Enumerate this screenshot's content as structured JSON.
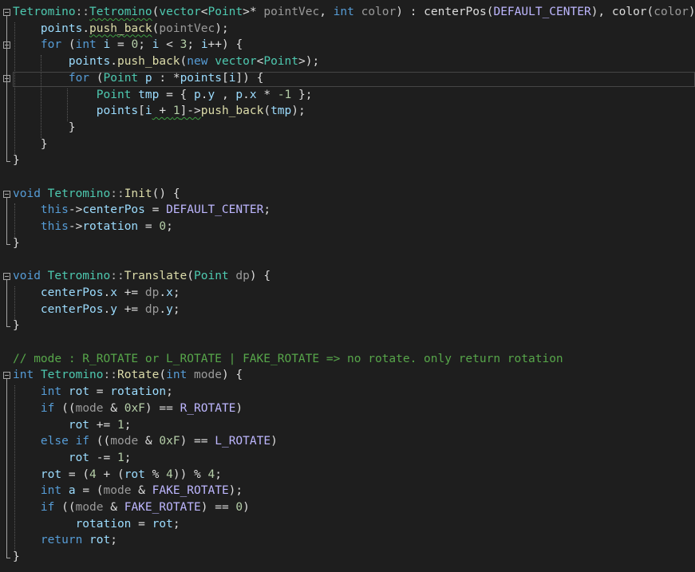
{
  "editor": {
    "lines": [
      {
        "tokens": [
          [
            "t",
            "Tetromino"
          ],
          [
            "o",
            "::"
          ],
          [
            "t",
            "Tetromino"
          ],
          [
            "d",
            "("
          ],
          [
            "t",
            "vector"
          ],
          [
            "d",
            "<"
          ],
          [
            "t",
            "Point"
          ],
          [
            "d",
            ">* "
          ],
          [
            "p",
            "pointVec"
          ],
          [
            "d",
            ", "
          ],
          [
            "k",
            "int"
          ],
          [
            "d",
            " "
          ],
          [
            "p",
            "color"
          ],
          [
            "d",
            ") : centerPos("
          ],
          [
            "m",
            "DEFAULT_CENTER"
          ],
          [
            "d",
            "), color("
          ],
          [
            "p",
            "color"
          ],
          [
            "d",
            ") {"
          ]
        ]
      },
      {
        "tokens": [
          [
            "d",
            "    "
          ],
          [
            "v",
            "points"
          ],
          [
            "d",
            "."
          ],
          [
            "f",
            "push_back"
          ],
          [
            "d",
            "("
          ],
          [
            "p",
            "pointVec"
          ],
          [
            "d",
            ");"
          ]
        ]
      },
      {
        "tokens": [
          [
            "d",
            "    "
          ],
          [
            "k",
            "for"
          ],
          [
            "d",
            " ("
          ],
          [
            "k",
            "int"
          ],
          [
            "d",
            " "
          ],
          [
            "v",
            "i"
          ],
          [
            "d",
            " = "
          ],
          [
            "n",
            "0"
          ],
          [
            "d",
            "; "
          ],
          [
            "v",
            "i"
          ],
          [
            "d",
            " < "
          ],
          [
            "n",
            "3"
          ],
          [
            "d",
            "; "
          ],
          [
            "v",
            "i"
          ],
          [
            "d",
            "++) {"
          ]
        ]
      },
      {
        "tokens": [
          [
            "d",
            "        "
          ],
          [
            "v",
            "points"
          ],
          [
            "d",
            "."
          ],
          [
            "f",
            "push_back"
          ],
          [
            "d",
            "("
          ],
          [
            "k",
            "new"
          ],
          [
            "d",
            " "
          ],
          [
            "t",
            "vector"
          ],
          [
            "d",
            "<"
          ],
          [
            "t",
            "Point"
          ],
          [
            "d",
            ">);"
          ]
        ]
      },
      {
        "tokens": [
          [
            "d",
            "        "
          ],
          [
            "k",
            "for"
          ],
          [
            "d",
            " ("
          ],
          [
            "t",
            "Point"
          ],
          [
            "d",
            " "
          ],
          [
            "v",
            "p"
          ],
          [
            "d",
            " : *"
          ],
          [
            "v",
            "points"
          ],
          [
            "d",
            "["
          ],
          [
            "v",
            "i"
          ],
          [
            "d",
            "]) {"
          ]
        ]
      },
      {
        "tokens": [
          [
            "d",
            "            "
          ],
          [
            "t",
            "Point"
          ],
          [
            "d",
            " "
          ],
          [
            "v",
            "tmp"
          ],
          [
            "d",
            " = { "
          ],
          [
            "v",
            "p"
          ],
          [
            "d",
            "."
          ],
          [
            "v",
            "y"
          ],
          [
            "d",
            " , "
          ],
          [
            "v",
            "p"
          ],
          [
            "d",
            "."
          ],
          [
            "v",
            "x"
          ],
          [
            "d",
            " * "
          ],
          [
            "n",
            "-1"
          ],
          [
            "d",
            " };"
          ]
        ]
      },
      {
        "tokens": [
          [
            "d",
            "            "
          ],
          [
            "v",
            "points"
          ],
          [
            "d",
            "["
          ],
          [
            "v",
            "i"
          ],
          [
            "d",
            " + "
          ],
          [
            "n",
            "1"
          ],
          [
            "d",
            "]->"
          ],
          [
            "f",
            "push_back"
          ],
          [
            "d",
            "("
          ],
          [
            "v",
            "tmp"
          ],
          [
            "d",
            ");"
          ]
        ]
      },
      {
        "tokens": [
          [
            "d",
            "        }"
          ]
        ]
      },
      {
        "tokens": [
          [
            "d",
            "    }"
          ]
        ]
      },
      {
        "tokens": [
          [
            "d",
            "}"
          ]
        ]
      },
      {
        "tokens": []
      },
      {
        "tokens": [
          [
            "k",
            "void"
          ],
          [
            "d",
            " "
          ],
          [
            "t",
            "Tetromino"
          ],
          [
            "o",
            "::"
          ],
          [
            "f",
            "Init"
          ],
          [
            "d",
            "() {"
          ]
        ]
      },
      {
        "tokens": [
          [
            "d",
            "    "
          ],
          [
            "k",
            "this"
          ],
          [
            "d",
            "->"
          ],
          [
            "v",
            "centerPos"
          ],
          [
            "d",
            " = "
          ],
          [
            "m",
            "DEFAULT_CENTER"
          ],
          [
            "d",
            ";"
          ]
        ]
      },
      {
        "tokens": [
          [
            "d",
            "    "
          ],
          [
            "k",
            "this"
          ],
          [
            "d",
            "->"
          ],
          [
            "v",
            "rotation"
          ],
          [
            "d",
            " = "
          ],
          [
            "n",
            "0"
          ],
          [
            "d",
            ";"
          ]
        ]
      },
      {
        "tokens": [
          [
            "d",
            "}"
          ]
        ]
      },
      {
        "tokens": []
      },
      {
        "tokens": [
          [
            "k",
            "void"
          ],
          [
            "d",
            " "
          ],
          [
            "t",
            "Tetromino"
          ],
          [
            "o",
            "::"
          ],
          [
            "f",
            "Translate"
          ],
          [
            "d",
            "("
          ],
          [
            "t",
            "Point"
          ],
          [
            "d",
            " "
          ],
          [
            "p",
            "dp"
          ],
          [
            "d",
            ") {"
          ]
        ]
      },
      {
        "tokens": [
          [
            "d",
            "    "
          ],
          [
            "v",
            "centerPos"
          ],
          [
            "d",
            "."
          ],
          [
            "v",
            "x"
          ],
          [
            "d",
            " += "
          ],
          [
            "p",
            "dp"
          ],
          [
            "d",
            "."
          ],
          [
            "v",
            "x"
          ],
          [
            "d",
            ";"
          ]
        ]
      },
      {
        "tokens": [
          [
            "d",
            "    "
          ],
          [
            "v",
            "centerPos"
          ],
          [
            "d",
            "."
          ],
          [
            "v",
            "y"
          ],
          [
            "d",
            " += "
          ],
          [
            "p",
            "dp"
          ],
          [
            "d",
            "."
          ],
          [
            "v",
            "y"
          ],
          [
            "d",
            ";"
          ]
        ]
      },
      {
        "tokens": [
          [
            "d",
            "}"
          ]
        ]
      },
      {
        "tokens": []
      },
      {
        "tokens": [
          [
            "c",
            "// mode : R_ROTATE or L_ROTATE | FAKE_ROTATE => no rotate. only return rotation"
          ]
        ]
      },
      {
        "tokens": [
          [
            "k",
            "int"
          ],
          [
            "d",
            " "
          ],
          [
            "t",
            "Tetromino"
          ],
          [
            "o",
            "::"
          ],
          [
            "f",
            "Rotate"
          ],
          [
            "d",
            "("
          ],
          [
            "k",
            "int"
          ],
          [
            "d",
            " "
          ],
          [
            "p",
            "mode"
          ],
          [
            "d",
            ") {"
          ]
        ]
      },
      {
        "tokens": [
          [
            "d",
            "    "
          ],
          [
            "k",
            "int"
          ],
          [
            "d",
            " "
          ],
          [
            "v",
            "rot"
          ],
          [
            "d",
            " = "
          ],
          [
            "v",
            "rotation"
          ],
          [
            "d",
            ";"
          ]
        ]
      },
      {
        "tokens": [
          [
            "d",
            "    "
          ],
          [
            "k",
            "if"
          ],
          [
            "d",
            " (("
          ],
          [
            "p",
            "mode"
          ],
          [
            "d",
            " & "
          ],
          [
            "n",
            "0xF"
          ],
          [
            "d",
            ") == "
          ],
          [
            "m",
            "R_ROTATE"
          ],
          [
            "d",
            ")"
          ]
        ]
      },
      {
        "tokens": [
          [
            "d",
            "        "
          ],
          [
            "v",
            "rot"
          ],
          [
            "d",
            " += "
          ],
          [
            "n",
            "1"
          ],
          [
            "d",
            ";"
          ]
        ]
      },
      {
        "tokens": [
          [
            "d",
            "    "
          ],
          [
            "k",
            "else"
          ],
          [
            "d",
            " "
          ],
          [
            "k",
            "if"
          ],
          [
            "d",
            " (("
          ],
          [
            "p",
            "mode"
          ],
          [
            "d",
            " & "
          ],
          [
            "n",
            "0xF"
          ],
          [
            "d",
            ") == "
          ],
          [
            "m",
            "L_ROTATE"
          ],
          [
            "d",
            ")"
          ]
        ]
      },
      {
        "tokens": [
          [
            "d",
            "        "
          ],
          [
            "v",
            "rot"
          ],
          [
            "d",
            " -= "
          ],
          [
            "n",
            "1"
          ],
          [
            "d",
            ";"
          ]
        ]
      },
      {
        "tokens": [
          [
            "d",
            "    "
          ],
          [
            "v",
            "rot"
          ],
          [
            "d",
            " = ("
          ],
          [
            "n",
            "4"
          ],
          [
            "d",
            " + ("
          ],
          [
            "v",
            "rot"
          ],
          [
            "d",
            " % "
          ],
          [
            "n",
            "4"
          ],
          [
            "d",
            ")) % "
          ],
          [
            "n",
            "4"
          ],
          [
            "d",
            ";"
          ]
        ]
      },
      {
        "tokens": [
          [
            "d",
            "    "
          ],
          [
            "k",
            "int"
          ],
          [
            "d",
            " "
          ],
          [
            "v",
            "a"
          ],
          [
            "d",
            " = ("
          ],
          [
            "p",
            "mode"
          ],
          [
            "d",
            " & "
          ],
          [
            "m",
            "FAKE_ROTATE"
          ],
          [
            "d",
            ");"
          ]
        ]
      },
      {
        "tokens": [
          [
            "d",
            "    "
          ],
          [
            "k",
            "if"
          ],
          [
            "d",
            " (("
          ],
          [
            "p",
            "mode"
          ],
          [
            "d",
            " & "
          ],
          [
            "m",
            "FAKE_ROTATE"
          ],
          [
            "d",
            ") == "
          ],
          [
            "n",
            "0"
          ],
          [
            "d",
            ")"
          ]
        ]
      },
      {
        "tokens": [
          [
            "d",
            "         "
          ],
          [
            "v",
            "rotation"
          ],
          [
            "d",
            " = "
          ],
          [
            "v",
            "rot"
          ],
          [
            "d",
            ";"
          ]
        ]
      },
      {
        "tokens": [
          [
            "d",
            "    "
          ],
          [
            "k",
            "return"
          ],
          [
            "d",
            " "
          ],
          [
            "v",
            "rot"
          ],
          [
            "d",
            ";"
          ]
        ]
      },
      {
        "tokens": [
          [
            "d",
            "}"
          ]
        ]
      }
    ],
    "colors": {
      "background": "#1e1e1e",
      "type": "#4ec9b0",
      "keyword": "#569cd6",
      "function": "#dcdcaa",
      "parameter": "#9a9a9a",
      "macro": "#beb7ff",
      "variable": "#9cdcfe",
      "number": "#b5cea8",
      "comment": "#57a64a",
      "default": "#dcdcdc"
    }
  }
}
